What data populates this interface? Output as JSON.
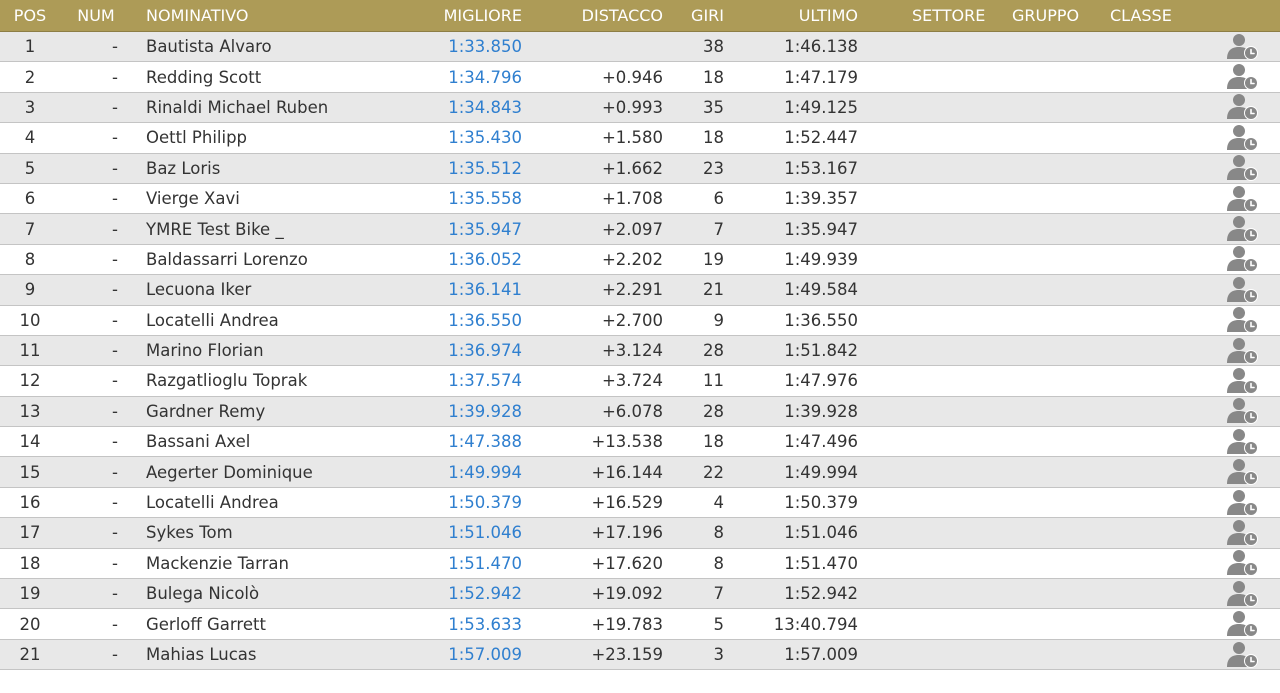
{
  "columns": {
    "pos": "POS",
    "num": "NUM",
    "name": "NOMINATIVO",
    "best": "MIGLIORE",
    "gap": "DISTACCO",
    "laps": "GIRI",
    "last": "ULTIMO",
    "sector": "SETTORE",
    "group": "GRUPPO",
    "class": "CLASSE"
  },
  "colors": {
    "header_bg": "#ad9b57",
    "best_time": "#2f7fcf",
    "row_alt": "#e8e8e8"
  },
  "row_icon": "rider-timing-icon",
  "rows": [
    {
      "pos": "1",
      "num": "-",
      "name": "Bautista Alvaro",
      "best": "1:33.850",
      "gap": "",
      "laps": "38",
      "last": "1:46.138"
    },
    {
      "pos": "2",
      "num": "-",
      "name": "Redding Scott",
      "best": "1:34.796",
      "gap": "+0.946",
      "laps": "18",
      "last": "1:47.179"
    },
    {
      "pos": "3",
      "num": "-",
      "name": "Rinaldi Michael Ruben",
      "best": "1:34.843",
      "gap": "+0.993",
      "laps": "35",
      "last": "1:49.125"
    },
    {
      "pos": "4",
      "num": "-",
      "name": "Oettl Philipp",
      "best": "1:35.430",
      "gap": "+1.580",
      "laps": "18",
      "last": "1:52.447"
    },
    {
      "pos": "5",
      "num": "-",
      "name": "Baz Loris",
      "best": "1:35.512",
      "gap": "+1.662",
      "laps": "23",
      "last": "1:53.167"
    },
    {
      "pos": "6",
      "num": "-",
      "name": "Vierge Xavi",
      "best": "1:35.558",
      "gap": "+1.708",
      "laps": "6",
      "last": "1:39.357"
    },
    {
      "pos": "7",
      "num": "-",
      "name": "YMRE Test Bike _",
      "best": "1:35.947",
      "gap": "+2.097",
      "laps": "7",
      "last": "1:35.947"
    },
    {
      "pos": "8",
      "num": "-",
      "name": "Baldassarri Lorenzo",
      "best": "1:36.052",
      "gap": "+2.202",
      "laps": "19",
      "last": "1:49.939"
    },
    {
      "pos": "9",
      "num": "-",
      "name": "Lecuona Iker",
      "best": "1:36.141",
      "gap": "+2.291",
      "laps": "21",
      "last": "1:49.584"
    },
    {
      "pos": "10",
      "num": "-",
      "name": "Locatelli Andrea",
      "best": "1:36.550",
      "gap": "+2.700",
      "laps": "9",
      "last": "1:36.550"
    },
    {
      "pos": "11",
      "num": "-",
      "name": "Marino Florian",
      "best": "1:36.974",
      "gap": "+3.124",
      "laps": "28",
      "last": "1:51.842"
    },
    {
      "pos": "12",
      "num": "-",
      "name": "Razgatlioglu Toprak",
      "best": "1:37.574",
      "gap": "+3.724",
      "laps": "11",
      "last": "1:47.976"
    },
    {
      "pos": "13",
      "num": "-",
      "name": "Gardner Remy",
      "best": "1:39.928",
      "gap": "+6.078",
      "laps": "28",
      "last": "1:39.928"
    },
    {
      "pos": "14",
      "num": "-",
      "name": "Bassani Axel",
      "best": "1:47.388",
      "gap": "+13.538",
      "laps": "18",
      "last": "1:47.496"
    },
    {
      "pos": "15",
      "num": "-",
      "name": "Aegerter Dominique",
      "best": "1:49.994",
      "gap": "+16.144",
      "laps": "22",
      "last": "1:49.994"
    },
    {
      "pos": "16",
      "num": "-",
      "name": "Locatelli Andrea",
      "best": "1:50.379",
      "gap": "+16.529",
      "laps": "4",
      "last": "1:50.379"
    },
    {
      "pos": "17",
      "num": "-",
      "name": "Sykes Tom",
      "best": "1:51.046",
      "gap": "+17.196",
      "laps": "8",
      "last": "1:51.046"
    },
    {
      "pos": "18",
      "num": "-",
      "name": "Mackenzie Tarran",
      "best": "1:51.470",
      "gap": "+17.620",
      "laps": "8",
      "last": "1:51.470"
    },
    {
      "pos": "19",
      "num": "-",
      "name": "Bulega Nicolò",
      "best": "1:52.942",
      "gap": "+19.092",
      "laps": "7",
      "last": "1:52.942"
    },
    {
      "pos": "20",
      "num": "-",
      "name": "Gerloff Garrett",
      "best": "1:53.633",
      "gap": "+19.783",
      "laps": "5",
      "last": "13:40.794"
    },
    {
      "pos": "21",
      "num": "-",
      "name": "Mahias Lucas",
      "best": "1:57.009",
      "gap": "+23.159",
      "laps": "3",
      "last": "1:57.009"
    }
  ]
}
